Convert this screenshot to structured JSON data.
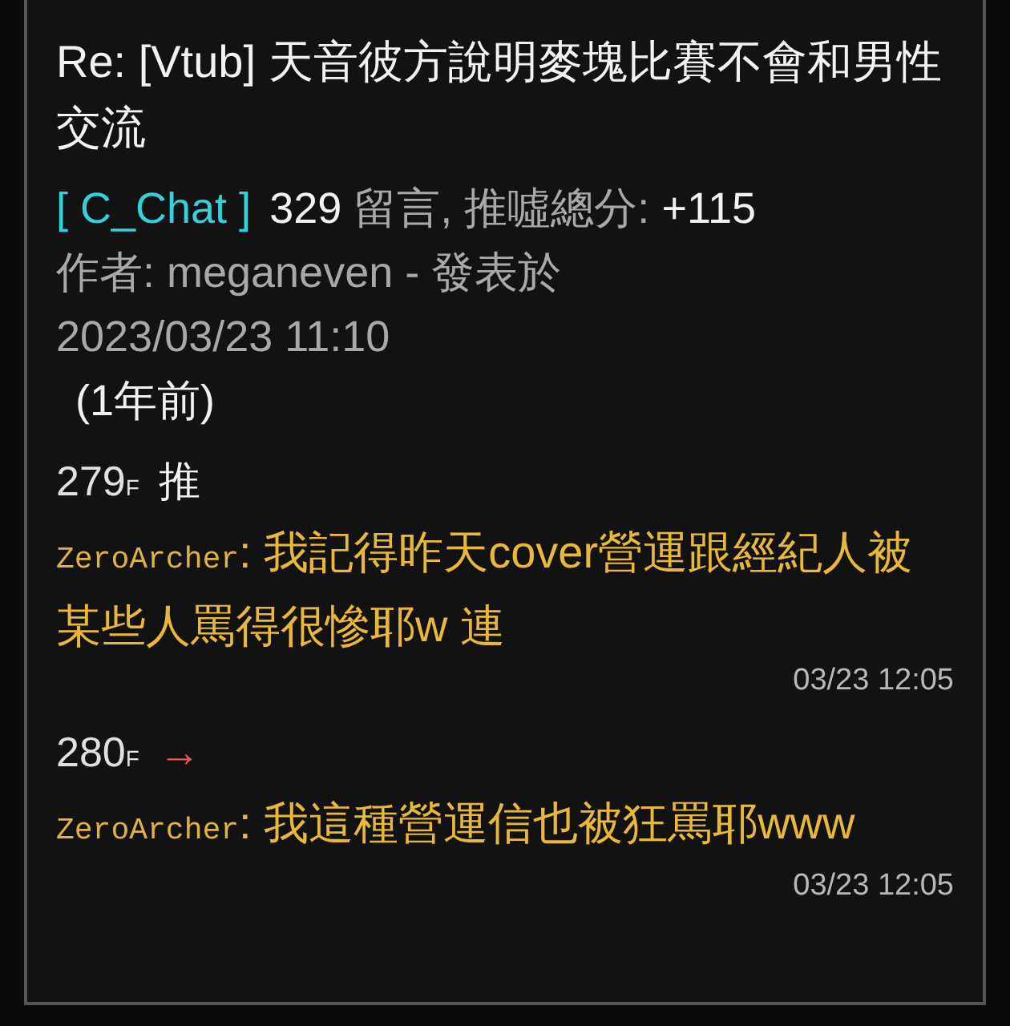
{
  "post": {
    "title": "Re: [Vtub] 天音彼方說明麥塊比賽不會和男性交流",
    "board": "[ C_Chat ]",
    "comment_count": "329",
    "count_label": "留言, 推噓總分:",
    "score": "+115",
    "author_line": "作者: meganeven - 發表於",
    "date": "2023/03/23 11:10",
    "age": "(1年前)"
  },
  "comments": [
    {
      "floor": "279",
      "floor_suffix": "F",
      "kind": "push",
      "tag": "推",
      "author": "ZeroArcher",
      "text": ": 我記得昨天cover營運跟經紀人被某些人罵得很慘耶w 連",
      "time": "03/23 12:05"
    },
    {
      "floor": "280",
      "floor_suffix": "F",
      "kind": "arrow",
      "tag": "→",
      "author": "ZeroArcher",
      "text": ": 我這種營運信也被狂罵耶www",
      "time": "03/23 12:05"
    }
  ]
}
